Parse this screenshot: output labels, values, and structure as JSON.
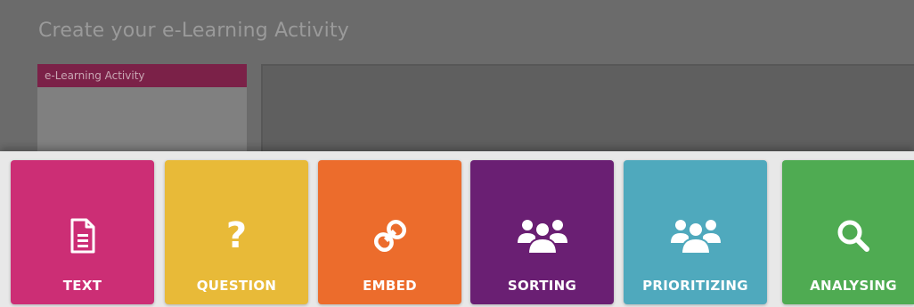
{
  "header": {
    "title": "Create your e-Learning Activity"
  },
  "activity_card": {
    "label": "e-Learning Activity"
  },
  "tiles": [
    {
      "label": "TEXT",
      "icon": "document-icon",
      "color": "#cc2e75"
    },
    {
      "label": "QUESTION",
      "icon": "question-icon",
      "color": "#e8ba38"
    },
    {
      "label": "EMBED",
      "icon": "link-icon",
      "color": "#ec6c2c"
    },
    {
      "label": "SORTING",
      "icon": "group-icon",
      "color": "#6a1f73"
    },
    {
      "label": "PRIORITIZING",
      "icon": "group-icon",
      "color": "#4fa9bd"
    },
    {
      "label": "ANALYSING",
      "icon": "search-icon",
      "color": "#4fab52"
    }
  ],
  "colors": {
    "overlay": "#6b6b6b",
    "card_header": "#7b2148",
    "tray": "#e8e8e8"
  }
}
